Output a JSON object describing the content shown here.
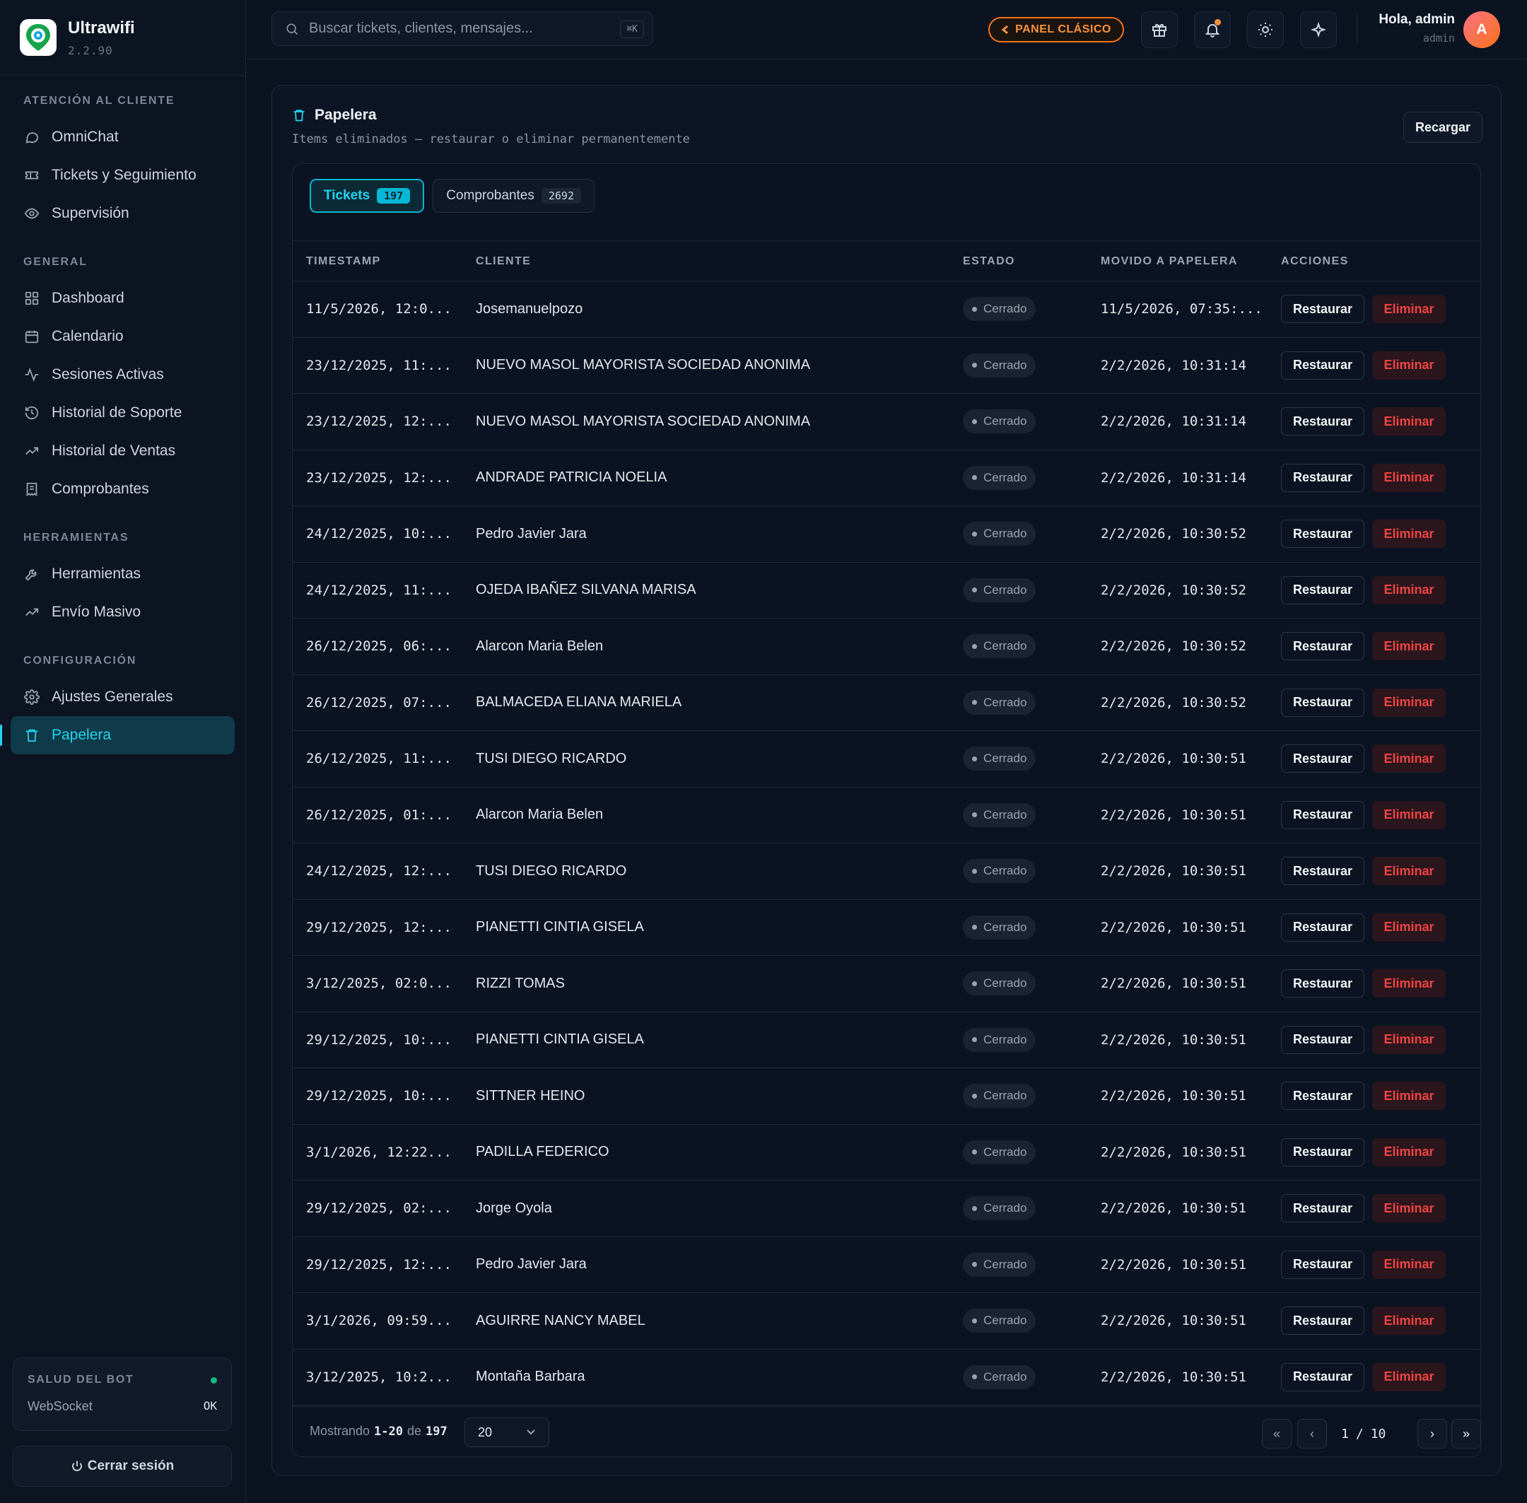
{
  "app": {
    "name": "Ultrawifi",
    "version": "2.2.90"
  },
  "sidebar": {
    "sections": [
      {
        "title": "ATENCIÓN AL CLIENTE",
        "items": [
          {
            "label": "OmniChat",
            "icon": "chat-icon"
          },
          {
            "label": "Tickets y Seguimiento",
            "icon": "ticket-icon"
          },
          {
            "label": "Supervisión",
            "icon": "eye-icon"
          }
        ]
      },
      {
        "title": "GENERAL",
        "items": [
          {
            "label": "Dashboard",
            "icon": "grid-icon"
          },
          {
            "label": "Calendario",
            "icon": "calendar-icon"
          },
          {
            "label": "Sesiones Activas",
            "icon": "activity-icon"
          },
          {
            "label": "Historial de Soporte",
            "icon": "history-icon"
          },
          {
            "label": "Historial de Ventas",
            "icon": "trending-up-icon"
          },
          {
            "label": "Comprobantes",
            "icon": "receipt-icon"
          }
        ]
      },
      {
        "title": "HERRAMIENTAS",
        "items": [
          {
            "label": "Herramientas",
            "icon": "wrench-icon"
          },
          {
            "label": "Envío Masivo",
            "icon": "trending-up-icon"
          }
        ]
      },
      {
        "title": "CONFIGURACIÓN",
        "items": [
          {
            "label": "Ajustes Generales",
            "icon": "gear-icon"
          },
          {
            "label": "Papelera",
            "icon": "trash-icon",
            "active": true
          }
        ]
      }
    ],
    "bot_health": {
      "title": "SALUD DEL BOT",
      "label": "WebSocket",
      "value": "OK",
      "status_color": "#10b981"
    },
    "logout_label": "Cerrar sesión"
  },
  "topbar": {
    "search_placeholder": "Buscar tickets, clientes, mensajes...",
    "search_shortcut": "⌘K",
    "classic_panel_label": "PANEL CLÁSICO",
    "greeting": "Hola, admin",
    "role": "admin",
    "avatar_initial": "A"
  },
  "page": {
    "title": "Papelera",
    "subtitle": "Items eliminados — restaurar o eliminar permanentemente",
    "reload_label": "Recargar",
    "tabs": [
      {
        "label": "Tickets",
        "count": "197",
        "active": true
      },
      {
        "label": "Comprobantes",
        "count": "2692",
        "active": false
      }
    ],
    "columns": [
      "TIMESTAMP",
      "CLIENTE",
      "ESTADO",
      "MOVIDO A PAPELERA",
      "ACCIONES"
    ],
    "restore_label": "Restaurar",
    "delete_label": "Eliminar",
    "rows": [
      {
        "timestamp": "11/5/2026, 12:0...",
        "client": "Josemanuelpozo",
        "status": "Cerrado",
        "moved": "11/5/2026, 07:35:..."
      },
      {
        "timestamp": "23/12/2025, 11:...",
        "client": "NUEVO MASOL MAYORISTA SOCIEDAD ANONIMA",
        "status": "Cerrado",
        "moved": "2/2/2026, 10:31:14"
      },
      {
        "timestamp": "23/12/2025, 12:...",
        "client": "NUEVO MASOL MAYORISTA SOCIEDAD ANONIMA",
        "status": "Cerrado",
        "moved": "2/2/2026, 10:31:14"
      },
      {
        "timestamp": "23/12/2025, 12:...",
        "client": "ANDRADE PATRICIA NOELIA",
        "status": "Cerrado",
        "moved": "2/2/2026, 10:31:14"
      },
      {
        "timestamp": "24/12/2025, 10:...",
        "client": "Pedro Javier Jara",
        "status": "Cerrado",
        "moved": "2/2/2026, 10:30:52"
      },
      {
        "timestamp": "24/12/2025, 11:...",
        "client": "OJEDA IBAÑEZ SILVANA MARISA",
        "status": "Cerrado",
        "moved": "2/2/2026, 10:30:52"
      },
      {
        "timestamp": "26/12/2025, 06:...",
        "client": "Alarcon Maria Belen",
        "status": "Cerrado",
        "moved": "2/2/2026, 10:30:52"
      },
      {
        "timestamp": "26/12/2025, 07:...",
        "client": "BALMACEDA ELIANA MARIELA",
        "status": "Cerrado",
        "moved": "2/2/2026, 10:30:52"
      },
      {
        "timestamp": "26/12/2025, 11:...",
        "client": "TUSI DIEGO RICARDO",
        "status": "Cerrado",
        "moved": "2/2/2026, 10:30:51"
      },
      {
        "timestamp": "26/12/2025, 01:...",
        "client": "Alarcon Maria Belen",
        "status": "Cerrado",
        "moved": "2/2/2026, 10:30:51"
      },
      {
        "timestamp": "24/12/2025, 12:...",
        "client": "TUSI DIEGO RICARDO",
        "status": "Cerrado",
        "moved": "2/2/2026, 10:30:51"
      },
      {
        "timestamp": "29/12/2025, 12:...",
        "client": "PIANETTI CINTIA GISELA",
        "status": "Cerrado",
        "moved": "2/2/2026, 10:30:51"
      },
      {
        "timestamp": "3/12/2025, 02:0...",
        "client": "RIZZI TOMAS",
        "status": "Cerrado",
        "moved": "2/2/2026, 10:30:51"
      },
      {
        "timestamp": "29/12/2025, 10:...",
        "client": "PIANETTI CINTIA GISELA",
        "status": "Cerrado",
        "moved": "2/2/2026, 10:30:51"
      },
      {
        "timestamp": "29/12/2025, 10:...",
        "client": "SITTNER HEINO",
        "status": "Cerrado",
        "moved": "2/2/2026, 10:30:51"
      },
      {
        "timestamp": "3/1/2026, 12:22...",
        "client": "PADILLA FEDERICO",
        "status": "Cerrado",
        "moved": "2/2/2026, 10:30:51"
      },
      {
        "timestamp": "29/12/2025, 02:...",
        "client": "Jorge Oyola",
        "status": "Cerrado",
        "moved": "2/2/2026, 10:30:51"
      },
      {
        "timestamp": "29/12/2025, 12:...",
        "client": "Pedro Javier Jara",
        "status": "Cerrado",
        "moved": "2/2/2026, 10:30:51"
      },
      {
        "timestamp": "3/1/2026, 09:59...",
        "client": "AGUIRRE NANCY MABEL",
        "status": "Cerrado",
        "moved": "2/2/2026, 10:30:51"
      },
      {
        "timestamp": "3/12/2025, 10:2...",
        "client": "Montaña Barbara",
        "status": "Cerrado",
        "moved": "2/2/2026, 10:30:51"
      }
    ],
    "pagination": {
      "showing_prefix": "Mostrando",
      "range": "1-20",
      "of_label": "de",
      "total": "197",
      "page_size": "20",
      "current_page": "1",
      "total_pages": "10",
      "separator": "/"
    }
  },
  "colors": {
    "accent": "#22d3ee",
    "danger": "#ef4444",
    "warning": "#f97316",
    "background": "#0b1220"
  }
}
